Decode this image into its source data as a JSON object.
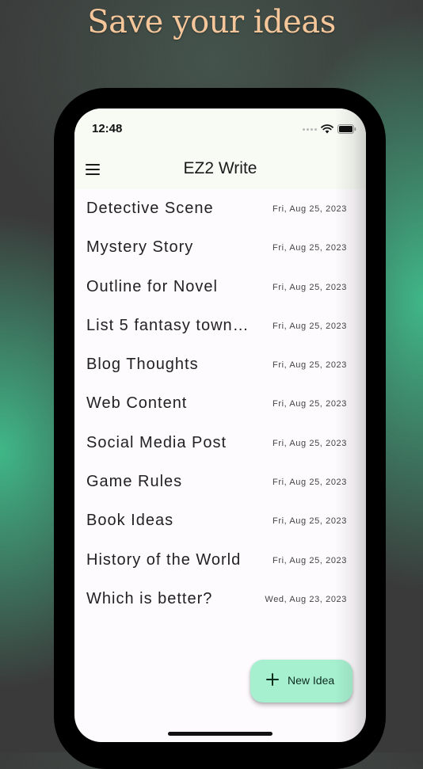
{
  "promo": {
    "headline": "Save your ideas"
  },
  "status_bar": {
    "time": "12:48",
    "icons": [
      "cellular-signal-icon",
      "wifi-icon",
      "battery-icon"
    ]
  },
  "app_bar": {
    "menu_icon": "hamburger-menu-icon",
    "title": "EZ2 Write"
  },
  "ideas": [
    {
      "title": "Detective Scene",
      "date": "Fri, Aug 25, 2023"
    },
    {
      "title": "Mystery Story",
      "date": "Fri, Aug 25, 2023"
    },
    {
      "title": "Outline for Novel",
      "date": "Fri, Aug 25, 2023"
    },
    {
      "title": "List 5 fantasy town…",
      "date": "Fri, Aug 25, 2023"
    },
    {
      "title": "Blog Thoughts",
      "date": "Fri, Aug 25, 2023"
    },
    {
      "title": "Web Content",
      "date": "Fri, Aug 25, 2023"
    },
    {
      "title": "Social Media Post",
      "date": "Fri, Aug 25, 2023"
    },
    {
      "title": "Game Rules",
      "date": "Fri, Aug 25, 2023"
    },
    {
      "title": "Book Ideas",
      "date": "Fri, Aug 25, 2023"
    },
    {
      "title": "History of the World",
      "date": "Fri, Aug 25, 2023"
    },
    {
      "title": "Which is better?",
      "date": "Wed, Aug 23, 2023"
    }
  ],
  "fab": {
    "icon": "plus-icon",
    "label": "New Idea"
  },
  "colors": {
    "headline": "#f5c69a",
    "accent_green": "#40be8c",
    "fab_background": "#a6f0cf",
    "app_bar_background": "#f8faf4",
    "screen_background": "#fefbfe"
  }
}
